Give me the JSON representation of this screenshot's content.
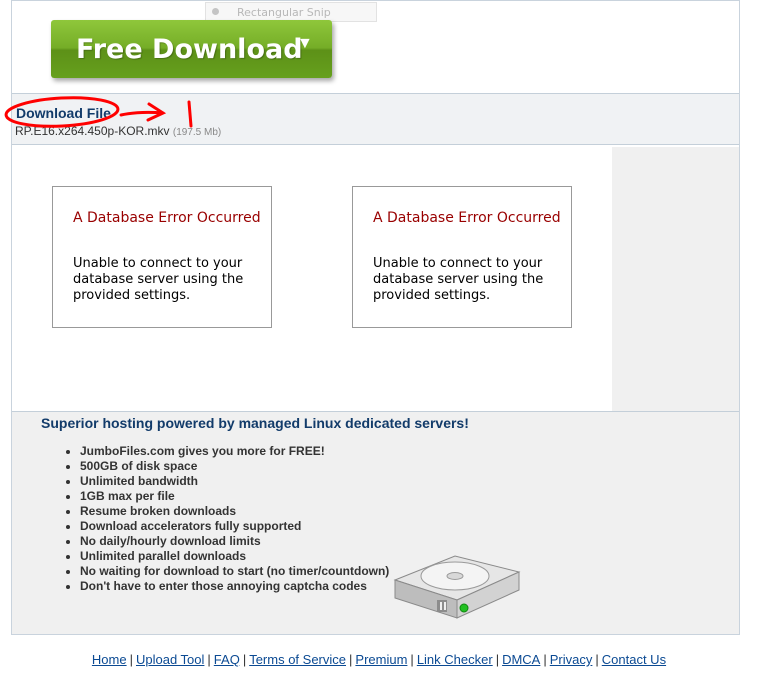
{
  "snip_tool": {
    "label": "Rectangular Snip"
  },
  "download_button": {
    "label": "Free Download",
    "arrow": "▼"
  },
  "file": {
    "section_title": "Download File",
    "name": "RP.E16.x264.450p-KOR.mkv",
    "size": "(197.5 Mb)"
  },
  "error_boxes": [
    {
      "title": "A Database Error Occurred",
      "message": "Unable to connect to your database server using the provided settings."
    },
    {
      "title": "A Database Error Occurred",
      "message": "Unable to connect to your database server using the provided settings."
    }
  ],
  "promo": {
    "headline": "Superior hosting powered by managed Linux dedicated servers!",
    "features": [
      "JumboFiles.com gives you more for FREE!",
      "500GB of disk space",
      "Unlimited bandwidth",
      "1GB max per file",
      "Resume broken downloads",
      "Download accelerators fully supported",
      "No daily/hourly download limits",
      "Unlimited parallel downloads",
      "No waiting for download to start (no timer/countdown)",
      "Don't have to enter those annoying captcha codes"
    ],
    "image_icon": "hard-drive-icon"
  },
  "footer": {
    "links": [
      "Home",
      "Upload Tool",
      "FAQ",
      "Terms of Service",
      "Premium",
      "Link Checker",
      "DMCA",
      "Privacy",
      "Contact Us"
    ],
    "separator": "|"
  },
  "colors": {
    "button_green": "#75ad27",
    "heading_blue": "#123b6a",
    "error_red": "#990000",
    "link_blue": "#0b4a93",
    "annotation_red": "#ff0000"
  }
}
